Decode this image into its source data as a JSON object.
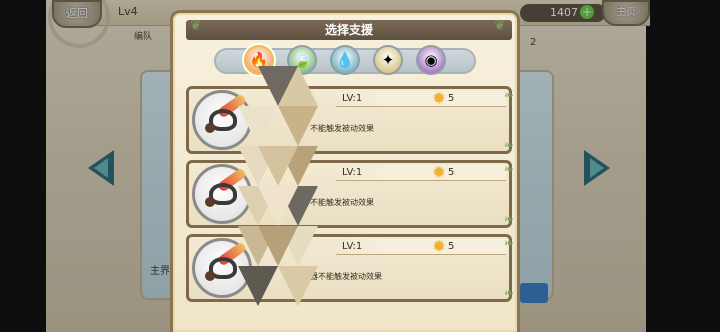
{
  "top_bar": {
    "back_label": "返回",
    "level": "Lv4",
    "team_label": "编队",
    "currency_value": "1407",
    "currency_plus": "+",
    "main_label": "主页"
  },
  "background": {
    "bottom_label": "主界",
    "page_num": "2"
  },
  "modal": {
    "title": "选择支援",
    "tabs": [
      {
        "name": "fire",
        "glyph": "🔥",
        "selected": true,
        "color": "#f08a3a"
      },
      {
        "name": "wind",
        "glyph": "🍃",
        "selected": false,
        "color": "#5aa85a"
      },
      {
        "name": "water",
        "glyph": "💧",
        "selected": false,
        "color": "#4a9ab0"
      },
      {
        "name": "light",
        "glyph": "✦",
        "selected": false,
        "color": "#c9b15a"
      },
      {
        "name": "dark",
        "glyph": "◉",
        "selected": false,
        "color": "#8a4ab0"
      }
    ],
    "items": [
      {
        "level": "LV:1",
        "stars": "5",
        "passive_note": "不能触发被动效果"
      },
      {
        "level": "LV:1",
        "stars": "5",
        "passive_note": "不能触发被动效果"
      },
      {
        "level": "LV:1",
        "stars": "5",
        "passive_note": "器不能触发被动效果"
      }
    ]
  },
  "colors": {
    "frame": "#7e6a4a",
    "title_bar": "#6a5b48",
    "star": "#f0b12c",
    "accent_green": "#6fd14a"
  }
}
